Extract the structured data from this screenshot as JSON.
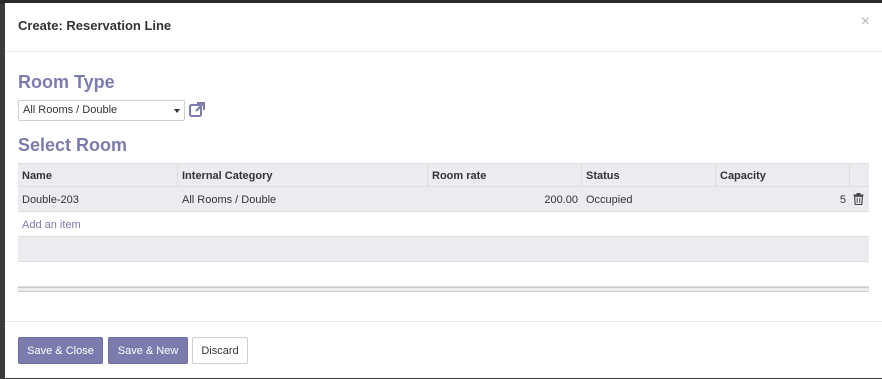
{
  "dialog": {
    "title": "Create: Reservation Line",
    "close_glyph": "×"
  },
  "room_type": {
    "heading": "Room Type",
    "selected": "All Rooms / Double",
    "link_icon": "external-link-icon"
  },
  "select_room": {
    "heading": "Select Room",
    "columns": [
      "Name",
      "Internal Category",
      "Room rate",
      "Status",
      "Capacity"
    ],
    "rows": [
      {
        "name": "Double-203",
        "category": "All Rooms / Double",
        "rate": "200.00",
        "status": "Occupied",
        "capacity": "5"
      }
    ],
    "add_item": "Add an item",
    "delete_icon": "trash-icon"
  },
  "footer": {
    "save_close": "Save & Close",
    "save_new": "Save & New",
    "discard": "Discard"
  },
  "colors": {
    "accent": "#7c7bad",
    "grid_bg": "#ebebf0"
  }
}
